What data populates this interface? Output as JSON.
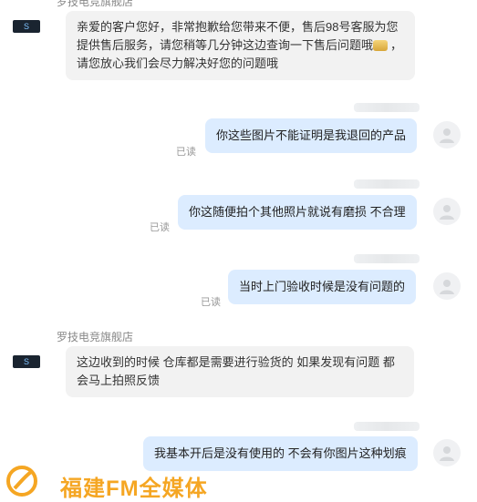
{
  "shop": {
    "name": "罗技电竞旗舰店",
    "avatar_glyph": "S"
  },
  "messages": [
    {
      "side": "left",
      "text": "亲爱的客户您好，非常抱歉给您带来不便，售后98号客服为您提供售后服务，请您稍等几分钟这边查询一下售后问题哦",
      "text_tail": "，请您放心我们会尽力解决好您的问题哦"
    },
    {
      "side": "right",
      "text": "你这些图片不能证明是我退回的产品",
      "status": "已读"
    },
    {
      "side": "right",
      "text": "你这随便拍个其他照片就说有磨损 不合理",
      "status": "已读"
    },
    {
      "side": "right",
      "text": "当时上门验收时候是没有问题的",
      "status": "已读"
    },
    {
      "side": "left",
      "text": "这边收到的时候 仓库都是需要进行验货的 如果发现有问题 都会马上拍照反馈"
    },
    {
      "side": "right",
      "text": "我基本开后是没有使用的 不会有你图片这种划痕"
    }
  ],
  "watermark": {
    "text": "福建FM全媒体"
  },
  "colors": {
    "right_bubble": "#dcecff",
    "left_bubble": "#f2f2f2",
    "watermark": "#f5a623"
  }
}
